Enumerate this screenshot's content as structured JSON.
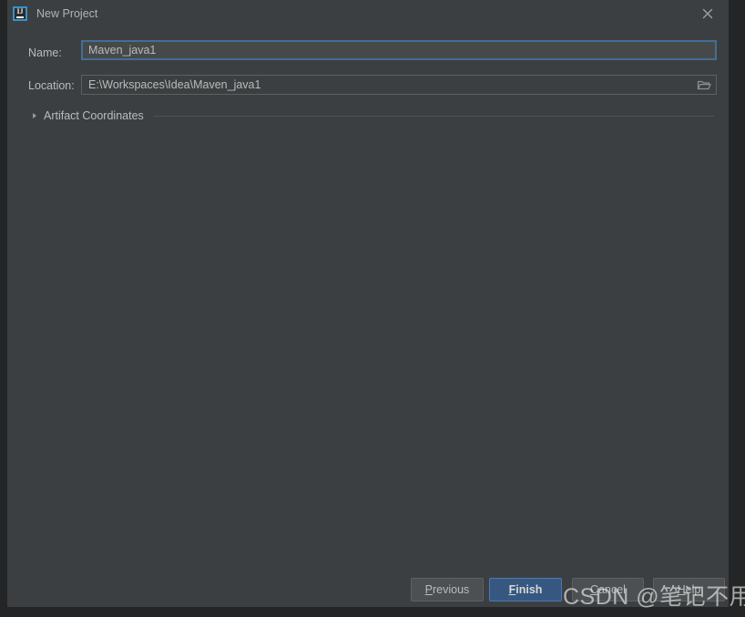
{
  "window": {
    "title": "New Project",
    "app_icon": "intellij-idea-icon",
    "icon_letters": "IJ",
    "close_icon": "close-icon"
  },
  "form": {
    "name": {
      "label": "Name:",
      "value": "Maven_java1",
      "placeholder": ""
    },
    "location": {
      "label": "Location:",
      "value": "E:\\Workspaces\\Idea\\Maven_java1",
      "placeholder": "",
      "browse_icon": "folder-icon"
    },
    "artifact_coordinates": {
      "label": "Artifact Coordinates",
      "expanded": false,
      "arrow_icon": "chevron-right-icon"
    }
  },
  "buttons": {
    "previous": {
      "label_before": "P",
      "label_mnemonic": "",
      "label": "Previous"
    },
    "finish": {
      "label": "Finish"
    },
    "cancel": {
      "label": "Cancel"
    },
    "help": {
      "label": "Help"
    }
  },
  "watermark": {
    "text": "CSDN @笔记不用笔"
  },
  "colors": {
    "dialog_background": "#3c3f41",
    "window_background": "#232527",
    "focus_border": "#466d94",
    "default_button": "#365880",
    "text": "#bbbbbb"
  }
}
